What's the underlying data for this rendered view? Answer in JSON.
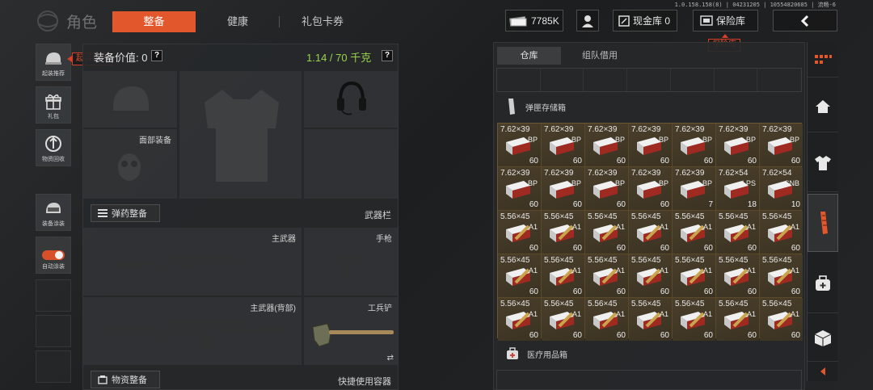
{
  "version_text": "1.0.158.158(8) | 04231205 | 10554820685 | 流畅-6",
  "header": {
    "section_title": "角色",
    "tabs": [
      {
        "label": "整备",
        "active": true
      },
      {
        "label": "健康",
        "active": false
      },
      {
        "label": "礼包卡券",
        "active": false
      }
    ],
    "currency": "7785K",
    "cash_vault": "现金库 0",
    "safe_box": "保险库",
    "safe_box_tooltip": "保险库"
  },
  "sidebar": {
    "items": [
      {
        "label": "起装推荐",
        "icon": "helmet-star-icon"
      },
      {
        "label": "礼包",
        "icon": "gift-icon"
      },
      {
        "label": "物资回收",
        "icon": "recycle-icon"
      },
      {
        "label": "装备涂装",
        "icon": "paint-helmet-icon"
      },
      {
        "label": "自动涂装",
        "icon": "toggle-icon",
        "toggle_on": true
      }
    ],
    "tooltip": "起装推荐"
  },
  "equipment": {
    "value_label": "装备价值: 0",
    "weight_label": "1.14 / 70 千克",
    "face_slot_label": "面部装备",
    "ammo_button": "弹药整备",
    "weapon_bar_label": "武器栏",
    "primary_label": "主武器",
    "pistol_label": "手枪",
    "primary_back_label": "主武器(背部)",
    "shovel_label": "工兵铲",
    "supplies_button": "物资整备",
    "quick_use_label": "快捷使用容器"
  },
  "warehouse": {
    "tabs": [
      {
        "label": "仓库",
        "active": true
      },
      {
        "label": "组队借用",
        "active": false
      }
    ],
    "ammo_box_label": "弹匣存储箱",
    "medical_box_label": "医疗用品箱",
    "ammo_items": [
      {
        "caliber": "7.62×39",
        "type": "BP",
        "count": "60"
      },
      {
        "caliber": "7.62×39",
        "type": "BP",
        "count": "60"
      },
      {
        "caliber": "7.62×39",
        "type": "BP",
        "count": "60"
      },
      {
        "caliber": "7.62×39",
        "type": "BP",
        "count": "60"
      },
      {
        "caliber": "7.62×39",
        "type": "BP",
        "count": "60"
      },
      {
        "caliber": "7.62×39",
        "type": "BP",
        "count": "60"
      },
      {
        "caliber": "7.62×39",
        "type": "BP",
        "count": "60"
      },
      {
        "caliber": "7.62×39",
        "type": "BP",
        "count": "60"
      },
      {
        "caliber": "7.62×39",
        "type": "BP",
        "count": "60"
      },
      {
        "caliber": "7.62×39",
        "type": "BP",
        "count": "60"
      },
      {
        "caliber": "7.62×39",
        "type": "BP",
        "count": "60"
      },
      {
        "caliber": "7.62×39",
        "type": "BP",
        "count": "7"
      },
      {
        "caliber": "7.62×54",
        "type": "LPS",
        "count": "18"
      },
      {
        "caliber": "7.62×54",
        "type": "SNB",
        "count": "10"
      },
      {
        "caliber": "5.56×45",
        "type": "A1",
        "count": "60"
      },
      {
        "caliber": "5.56×45",
        "type": "A1",
        "count": "60"
      },
      {
        "caliber": "5.56×45",
        "type": "A1",
        "count": "60"
      },
      {
        "caliber": "5.56×45",
        "type": "A1",
        "count": "60"
      },
      {
        "caliber": "5.56×45",
        "type": "A1",
        "count": "60"
      },
      {
        "caliber": "5.56×45",
        "type": "A1",
        "count": "60"
      },
      {
        "caliber": "5.56×45",
        "type": "A1",
        "count": "60"
      },
      {
        "caliber": "5.56×45",
        "type": "A1",
        "count": "60"
      },
      {
        "caliber": "5.56×45",
        "type": "A1",
        "count": "60"
      },
      {
        "caliber": "5.56×45",
        "type": "A1",
        "count": "60"
      },
      {
        "caliber": "5.56×45",
        "type": "A1",
        "count": "60"
      },
      {
        "caliber": "5.56×45",
        "type": "A1",
        "count": "60"
      },
      {
        "caliber": "5.56×45",
        "type": "A1",
        "count": "60"
      },
      {
        "caliber": "5.56×45",
        "type": "A1",
        "count": "60"
      },
      {
        "caliber": "5.56×45",
        "type": "A1",
        "count": "60"
      },
      {
        "caliber": "5.56×45",
        "type": "A1",
        "count": "60"
      },
      {
        "caliber": "5.56×45",
        "type": "A1",
        "count": "60"
      },
      {
        "caliber": "5.56×45",
        "type": "A1",
        "count": "60"
      },
      {
        "caliber": "5.56×45",
        "type": "A1",
        "count": "60"
      },
      {
        "caliber": "5.56×45",
        "type": "A1",
        "count": "60"
      },
      {
        "caliber": "5.56×45",
        "type": "A1",
        "count": "60"
      }
    ]
  },
  "rail": {
    "items": [
      "home-icon",
      "shirt-icon",
      "magazine-icon",
      "medkit-icon",
      "box-icon"
    ]
  },
  "colors": {
    "accent": "#e2572c",
    "weight_green": "#9ad34b",
    "tooltip_red": "#d6402a",
    "ammo_cell": "#4a3f2b"
  }
}
